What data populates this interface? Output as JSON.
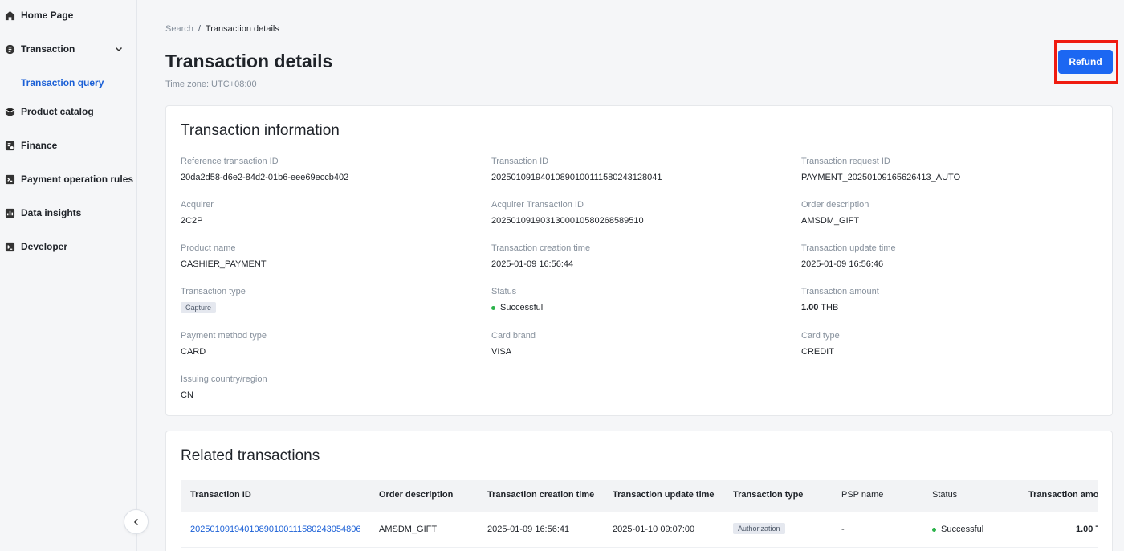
{
  "sidebar": {
    "items": [
      {
        "label": "Home Page",
        "icon": "home-icon"
      },
      {
        "label": "Transaction",
        "icon": "transaction-icon"
      },
      {
        "label": "Product catalog",
        "icon": "box-icon"
      },
      {
        "label": "Finance",
        "icon": "finance-icon"
      },
      {
        "label": "Payment operation rules",
        "icon": "rules-icon"
      },
      {
        "label": "Data insights",
        "icon": "chart-icon"
      },
      {
        "label": "Developer",
        "icon": "terminal-icon"
      }
    ],
    "subitem": {
      "label": "Transaction query"
    }
  },
  "breadcrumb": {
    "parent": "Search",
    "separator": "/",
    "current": "Transaction details"
  },
  "header": {
    "title": "Transaction details",
    "timezone": "Time zone: UTC+08:00",
    "refund_label": "Refund"
  },
  "info": {
    "title": "Transaction information",
    "ref_id": {
      "label": "Reference transaction ID",
      "value": "20da2d58-d6e2-84d2-01b6-eee69eccb402"
    },
    "txn_id": {
      "label": "Transaction ID",
      "value": "20250109194010890100111580243128041"
    },
    "req_id": {
      "label": "Transaction request ID",
      "value": "PAYMENT_20250109165626413_AUTO"
    },
    "acquirer": {
      "label": "Acquirer",
      "value": "2C2P"
    },
    "acq_txn_id": {
      "label": "Acquirer Transaction ID",
      "value": "20250109190313000105802685895​10"
    },
    "order_desc": {
      "label": "Order description",
      "value": "AMSDM_GIFT"
    },
    "product": {
      "label": "Product name",
      "value": "CASHIER_PAYMENT"
    },
    "created": {
      "label": "Transaction creation time",
      "value": "2025-01-09 16:56:44"
    },
    "updated": {
      "label": "Transaction update time",
      "value": "2025-01-09 16:56:46"
    },
    "type": {
      "label": "Transaction type",
      "value": "Capture"
    },
    "status": {
      "label": "Status",
      "value": "Successful"
    },
    "amount": {
      "label": "Transaction amount",
      "value": "1.00",
      "currency": "THB"
    },
    "pm_type": {
      "label": "Payment method type",
      "value": "CARD"
    },
    "card_brand": {
      "label": "Card brand",
      "value": "VISA"
    },
    "card_type": {
      "label": "Card type",
      "value": "CREDIT"
    },
    "country": {
      "label": "Issuing country/region",
      "value": "CN"
    }
  },
  "related": {
    "title": "Related transactions",
    "columns": [
      "Transaction ID",
      "Order description",
      "Transaction creation time",
      "Transaction update time",
      "Transaction type",
      "PSP name",
      "Status",
      "Transaction amo"
    ],
    "rows": [
      {
        "txn_id": "20250109194010890100111580243054806",
        "order_desc": "AMSDM_GIFT",
        "created": "2025-01-09 16:56:41",
        "updated": "2025-01-10 09:07:00",
        "type": "Authorization",
        "psp": "-",
        "status": "Successful",
        "amount": "1.00 T"
      }
    ]
  },
  "colors": {
    "accent": "#1c67f2",
    "link": "#1a5fd6",
    "success": "#2bb24a",
    "highlight": "#ef1b10"
  }
}
